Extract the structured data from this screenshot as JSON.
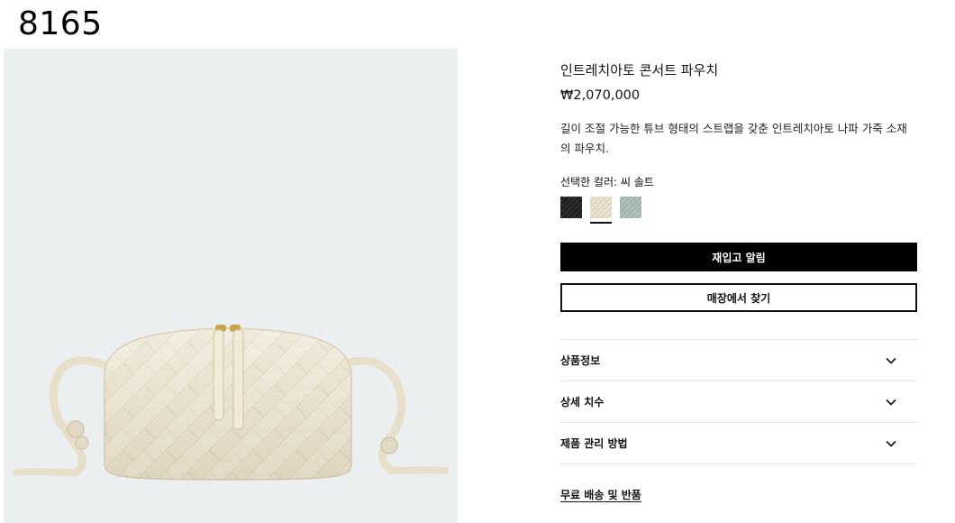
{
  "page_code": "8165",
  "product": {
    "title": "인트레치아토 콘서트 파우치",
    "price": "₩2,070,000",
    "description": "길이 조절 가능한 튜브 형태의 스트랩을 갖춘 인트레치아토 나파 가죽 소재의 파우치.",
    "selected_color_label": "선택한 컬러: 씨 솔트",
    "image_icon": "woven-pouch-bag-photo"
  },
  "swatches": [
    {
      "name": "black",
      "color": "#1c1c1c",
      "selected": false
    },
    {
      "name": "sea-salt",
      "color": "#e8e1cf",
      "selected": true
    },
    {
      "name": "sage",
      "color": "#aebfb7",
      "selected": false
    }
  ],
  "buttons": {
    "restock_alert": "재입고 알림",
    "find_in_store": "매장에서 찾기"
  },
  "accordion": [
    {
      "label": "상품정보",
      "icon": "chevron-down-icon"
    },
    {
      "label": "상세 치수",
      "icon": "chevron-down-icon"
    },
    {
      "label": "제품 관리 방법",
      "icon": "chevron-down-icon"
    }
  ],
  "links": {
    "shipping_returns": "무료 배송 및 반품"
  },
  "colors": {
    "primary_button_bg": "#000000",
    "photo_bg": "#ecefef",
    "bag_leather": "#efe8d6"
  }
}
